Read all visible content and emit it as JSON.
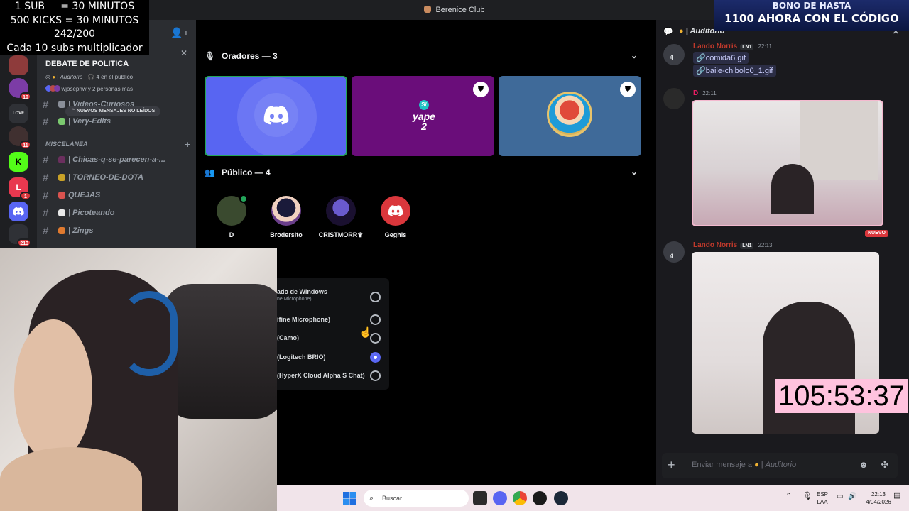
{
  "window": {
    "title": "Berenice Club"
  },
  "overlay": {
    "lines": [
      "1 SUB     = 30 MINUTOS",
      "500 KICKS = 30 MINUTOS",
      "242/200",
      "Cada 10 subs multiplicador"
    ]
  },
  "servers": {
    "badges": [
      "19",
      "11",
      "1",
      "213"
    ]
  },
  "event": {
    "title": "DEBATE DE POLITICA",
    "channel": "Auditorio",
    "listeners": "4 en el público",
    "users": "wjosephw y 2 personas más"
  },
  "new_messages_pill": "NUEVOS MENSAJES NO LEÍDOS",
  "channels_top": [
    {
      "name": "Videos-Curiosos",
      "color": "#8a8f99"
    },
    {
      "name": "Very-Edits",
      "color": "#7bc96f"
    }
  ],
  "category": "MISCELANEA",
  "channels": [
    {
      "name": "Chicas-q-se-parecen-a-...",
      "color": "#6b2f5e"
    },
    {
      "name": "TORNEO-DE-DOTA",
      "color": "#c9a227"
    },
    {
      "name": "QUEJAS",
      "color": "#d9534f"
    },
    {
      "name": "Picoteando",
      "color": "#e8e8e8"
    },
    {
      "name": "Zings",
      "color": "#e07a2f"
    }
  ],
  "stage": {
    "speakers_title": "Oradores — 3",
    "audience_title": "Público — 4",
    "speaker_tiles": [
      {
        "label": "",
        "color": "#5865f2"
      },
      {
        "label": "yape 2",
        "color": "#6a0d7a"
      },
      {
        "label": "",
        "color": "#3f6a99"
      }
    ],
    "audience": [
      {
        "name": "D",
        "color": "#3a4a2f"
      },
      {
        "name": "Brodersito",
        "color": "#3a2e4d"
      },
      {
        "name": "CRISTMORR♛",
        "color": "#2a1d4a"
      },
      {
        "name": "Geghis",
        "color": "#da373c"
      }
    ]
  },
  "device_menu": {
    "items": [
      {
        "label": "ado de Windows",
        "sub": "ne Microphone)",
        "selected": false
      },
      {
        "label": "ifine Microphone)",
        "sub": "",
        "selected": false
      },
      {
        "label": "(Camo)",
        "sub": "",
        "selected": false
      },
      {
        "label": "(Logitech BRIO)",
        "sub": "",
        "selected": true
      },
      {
        "label": "(HyperX Cloud Alpha S Chat)",
        "sub": "",
        "selected": false
      }
    ]
  },
  "promo": {
    "line1": "BONO DE HASTA",
    "line2": "1100 AHORA CON EL CÓDIGO"
  },
  "chat": {
    "channel": "Auditorio",
    "messages": [
      {
        "author": "Lando Norris",
        "level": "4",
        "tag": "LN1",
        "time": "22:11",
        "attachments": [
          "comida6.gif",
          "baile-chibolo0_1.gif"
        ]
      },
      {
        "author": "D",
        "level": "",
        "tag": "",
        "time": "22:11"
      },
      {
        "author": "Lando Norris",
        "level": "4",
        "tag": "LN1",
        "time": "22:13"
      }
    ],
    "new_label": "NUEVO",
    "composer_placeholder": "Enviar mensaje a",
    "composer_channel": "Auditorio"
  },
  "timer": "105:53:37",
  "taskbar": {
    "search": "Buscar",
    "lang": [
      "ESP",
      "LAA"
    ],
    "time": "22:13",
    "date": "4/04/2026"
  }
}
